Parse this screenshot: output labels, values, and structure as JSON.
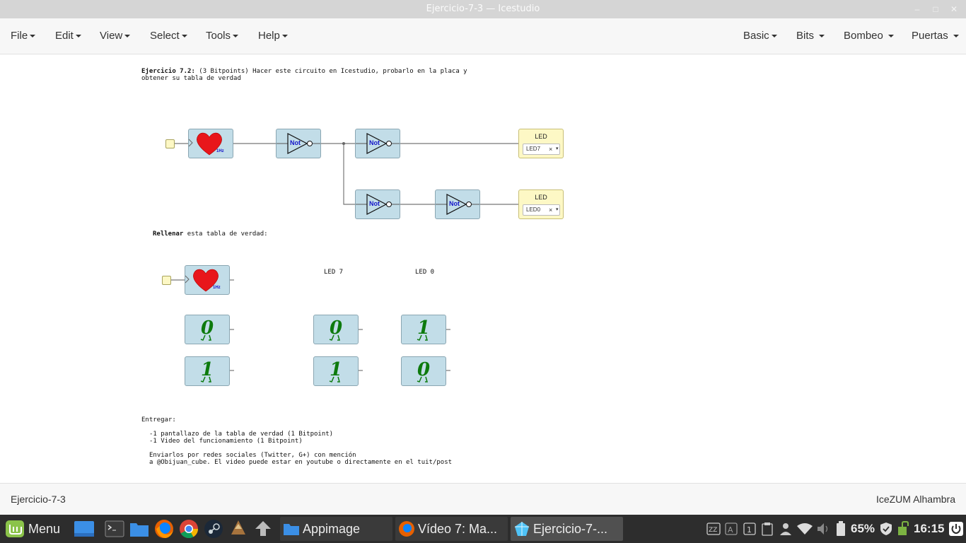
{
  "window": {
    "title": "Ejercicio-7-3 — Icestudio",
    "minimize": "–",
    "maximize": "□",
    "close": "✕"
  },
  "menubar": {
    "left": [
      "File",
      "Edit",
      "View",
      "Select",
      "Tools",
      "Help"
    ],
    "right": [
      "Basic",
      "Bits",
      "Bombeo",
      "Puertas"
    ]
  },
  "canvas": {
    "intro_bold": "Ejercicio 7.2:",
    "intro_rest": " (3 Bitpoints) Hacer este circuito en Icestudio, probarlo en la placa y",
    "intro_line2": "obtener su tabla de verdad",
    "gate_label": "Not",
    "clock_label": "1Hz",
    "led_block_title": "LED",
    "led_a_value": "LED7",
    "led_b_value": "LED0",
    "select_clear": "×",
    "select_arrow": "▾",
    "fill_bold": "Rellenar",
    "fill_rest": " esta tabla de verdad:",
    "col_led7": "LED 7",
    "col_led0": "LED 0",
    "truth_table": {
      "clock_values": [
        "0",
        "1"
      ],
      "led7_values": [
        "0",
        "1"
      ],
      "led0_values": [
        "1",
        "0"
      ]
    },
    "deliver_title": "Entregar:",
    "deliver_items": [
      "-1 pantallazo de la tabla de verdad (1 Bitpoint)",
      "-1 Video del funcionamiento (1 Bitpoint)"
    ],
    "send_line1": "Enviarlos por redes sociales (Twitter, G+) con mención",
    "send_line2": "a @Obijuan_cube. El video puede estar en youtube o directamente en el tuit/post"
  },
  "statusbar": {
    "left": "Ejercicio-7-3",
    "right": "IceZUM Alhambra"
  },
  "taskbar": {
    "menu_label": "Menu",
    "windows": [
      "Appimage",
      "Vídeo 7: Ma...",
      "Ejercicio-7-..."
    ],
    "battery": "65%",
    "clock": "16:15"
  },
  "colors": {
    "block_fill": "#c2dde8",
    "led_fill": "#fdf8c5",
    "heart": "#e8161b",
    "digit": "#0d7a0d",
    "not_text": "#1515c8",
    "taskbar": "#2d2d2d"
  }
}
